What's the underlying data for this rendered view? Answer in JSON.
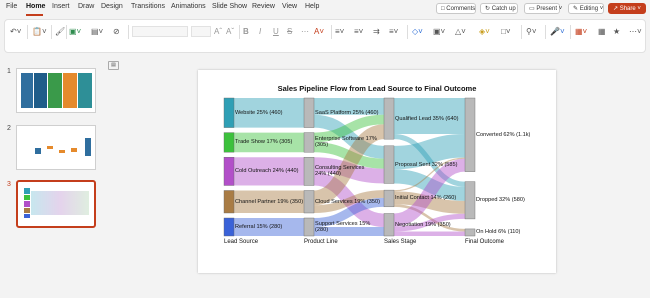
{
  "menu": {
    "items": [
      "File",
      "Home",
      "Insert",
      "Draw",
      "Design",
      "Transitions",
      "Animations",
      "Slide Show",
      "Review",
      "View",
      "Help"
    ],
    "comments": "Comments",
    "catchup": "Catch up",
    "present": "Present",
    "editing": "Editing",
    "share": "Share"
  },
  "ribbon": {
    "icons": [
      "undo-icon",
      "paste-icon",
      "new-slide-icon",
      "layout-icon",
      "format-painter-icon",
      "font-box",
      "font-size-box",
      "bold-icon",
      "italic-icon",
      "underline-icon",
      "strikethrough-icon",
      "font-color-icon",
      "bullets-icon",
      "numbering-icon",
      "align-icon",
      "shapes-icon",
      "arrange-icon",
      "quick-styles-icon",
      "fill-icon",
      "find-icon",
      "dictate-icon",
      "designer-icon",
      "more-icon"
    ]
  },
  "thumbnails": [
    {
      "number": "1"
    },
    {
      "number": "2"
    },
    {
      "number": "3"
    }
  ],
  "slide": {
    "title": "Sales Pipeline Flow from Lead Source to Final Outcome",
    "stages": [
      "Lead Source",
      "Product Line",
      "Sales Stage",
      "Final Outcome"
    ]
  },
  "chart_data": {
    "type": "sankey",
    "title": "Sales Pipeline Flow from Lead Source to Final Outcome",
    "stages": [
      "Lead Source",
      "Product Line",
      "Sales Stage",
      "Final Outcome"
    ],
    "nodes": [
      {
        "id": "website",
        "label": "Website 25% (460)",
        "stage": 0,
        "value": 460,
        "color": "#2f9fb5"
      },
      {
        "id": "trade",
        "label": "Trade Show 17% (305)",
        "stage": 0,
        "value": 305,
        "color": "#3cc13c"
      },
      {
        "id": "cold",
        "label": "Cold Outreach 24% (440)",
        "stage": 0,
        "value": 440,
        "color": "#b24fc9"
      },
      {
        "id": "channel",
        "label": "Channel Partner 19% (350)",
        "stage": 0,
        "value": 350,
        "color": "#a97c45"
      },
      {
        "id": "referral",
        "label": "Referral 15% (280)",
        "stage": 0,
        "value": 280,
        "color": "#3a62d8"
      },
      {
        "id": "saas",
        "label": "SaaS Platform 25% (460)",
        "stage": 1,
        "value": 460,
        "color": "#b9b9b9"
      },
      {
        "id": "enterprise",
        "label": "Enterprise Software 17% (305)",
        "stage": 1,
        "value": 305,
        "color": "#b9b9b9"
      },
      {
        "id": "consulting",
        "label": "Consulting Services 24% (440)",
        "stage": 1,
        "value": 440,
        "color": "#b9b9b9"
      },
      {
        "id": "cloud",
        "label": "Cloud Services 19% (350)",
        "stage": 1,
        "value": 350,
        "color": "#b9b9b9"
      },
      {
        "id": "support",
        "label": "Support Services 15% (280)",
        "stage": 1,
        "value": 280,
        "color": "#b9b9b9"
      },
      {
        "id": "qualified",
        "label": "Qualified Lead 35% (640)",
        "stage": 2,
        "value": 640,
        "color": "#b9b9b9"
      },
      {
        "id": "proposal",
        "label": "Proposal Sent 32% (585)",
        "stage": 2,
        "value": 585,
        "color": "#b9b9b9"
      },
      {
        "id": "initial",
        "label": "Initial Contact 14% (260)",
        "stage": 2,
        "value": 260,
        "color": "#b9b9b9"
      },
      {
        "id": "negotiation",
        "label": "Negotiation 19% (350)",
        "stage": 2,
        "value": 350,
        "color": "#b9b9b9"
      },
      {
        "id": "converted",
        "label": "Converted 62% (1.1k)",
        "stage": 3,
        "value": 1145,
        "color": "#b9b9b9"
      },
      {
        "id": "dropped",
        "label": "Dropped 32% (580)",
        "stage": 3,
        "value": 580,
        "color": "#b9b9b9"
      },
      {
        "id": "onhold",
        "label": "On Hold 6% (110)",
        "stage": 3,
        "value": 110,
        "color": "#b9b9b9"
      }
    ],
    "links": [
      {
        "source": "website",
        "target": "saas",
        "value": 460
      },
      {
        "source": "trade",
        "target": "enterprise",
        "value": 305
      },
      {
        "source": "cold",
        "target": "consulting",
        "value": 440
      },
      {
        "source": "channel",
        "target": "cloud",
        "value": 350
      },
      {
        "source": "referral",
        "target": "support",
        "value": 280
      },
      {
        "source": "saas",
        "target": "qualified",
        "value": 260
      },
      {
        "source": "saas",
        "target": "proposal",
        "value": 200
      },
      {
        "source": "enterprise",
        "target": "qualified",
        "value": 150
      },
      {
        "source": "enterprise",
        "target": "proposal",
        "value": 155
      },
      {
        "source": "consulting",
        "target": "proposal",
        "value": 230
      },
      {
        "source": "consulting",
        "target": "negotiation",
        "value": 210
      },
      {
        "source": "cloud",
        "target": "qualified",
        "value": 230
      },
      {
        "source": "cloud",
        "target": "initial",
        "value": 120
      },
      {
        "source": "support",
        "target": "initial",
        "value": 140
      },
      {
        "source": "support",
        "target": "negotiation",
        "value": 140
      },
      {
        "source": "qualified",
        "target": "converted",
        "value": 560
      },
      {
        "source": "qualified",
        "target": "dropped",
        "value": 80
      },
      {
        "source": "proposal",
        "target": "converted",
        "value": 365
      },
      {
        "source": "proposal",
        "target": "dropped",
        "value": 220
      },
      {
        "source": "initial",
        "target": "converted",
        "value": 20
      },
      {
        "source": "initial",
        "target": "dropped",
        "value": 200
      },
      {
        "source": "initial",
        "target": "onhold",
        "value": 40
      },
      {
        "source": "negotiation",
        "target": "converted",
        "value": 200
      },
      {
        "source": "negotiation",
        "target": "dropped",
        "value": 80
      },
      {
        "source": "negotiation",
        "target": "onhold",
        "value": 70
      }
    ]
  }
}
